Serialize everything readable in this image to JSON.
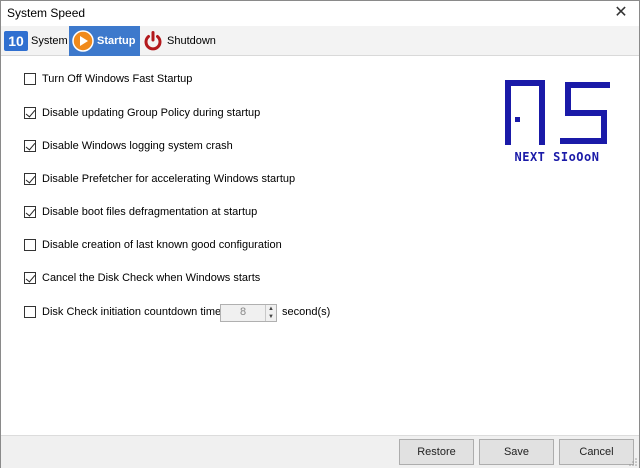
{
  "window": {
    "title": "System Speed",
    "close_glyph": "✕"
  },
  "tabs": [
    {
      "label": "System",
      "icon": "windows-10-icon",
      "active": false
    },
    {
      "label": "Startup",
      "icon": "play-icon",
      "active": true
    },
    {
      "label": "Shutdown",
      "icon": "power-icon",
      "active": false
    }
  ],
  "options": [
    {
      "label": "Turn Off Windows Fast Startup",
      "checked": false
    },
    {
      "label": "Disable updating Group Policy during startup",
      "checked": true
    },
    {
      "label": "Disable Windows logging system crash",
      "checked": true
    },
    {
      "label": "Disable Prefetcher for accelerating Windows startup",
      "checked": true
    },
    {
      "label": "Disable boot files defragmentation at startup",
      "checked": true
    },
    {
      "label": "Disable creation of last known good configuration",
      "checked": false
    },
    {
      "label": "Cancel the Disk Check when Windows starts",
      "checked": true
    },
    {
      "label": "Disk Check initiation countdown time",
      "checked": false
    }
  ],
  "countdown": {
    "value": "8",
    "unit_label": "second(s)"
  },
  "watermark": {
    "text": "NEXT SIoOoN"
  },
  "footer": {
    "restore_label": "Restore",
    "save_label": "Save",
    "cancel_label": "Cancel"
  },
  "colors": {
    "active_tab": "#3d79cc",
    "logo_blue": "#1a1aa8",
    "power_red": "#b3191d",
    "play_orange": "#f08a1c"
  }
}
